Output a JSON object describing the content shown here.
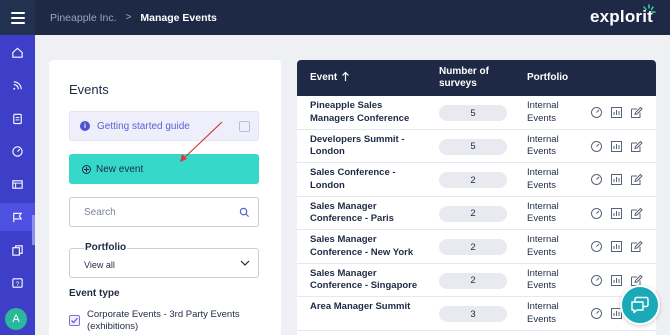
{
  "header": {
    "org": "Pineapple Inc.",
    "separator": ">",
    "page": "Manage Events",
    "logo_text": "explorit"
  },
  "nav": {
    "items": [
      "home-icon",
      "feed-icon",
      "clipboard-icon",
      "gauge-icon",
      "browser-icon",
      "flag-icon",
      "copy-icon",
      "help-icon"
    ],
    "active": "flag-icon",
    "avatar_initial": "A"
  },
  "panel": {
    "title": "Events",
    "guide_label": "Getting started guide",
    "new_event_label": "New event",
    "search_placeholder": "Search",
    "portfolio_label": "Portfolio",
    "portfolio_value": "View all",
    "event_type_title": "Event type",
    "event_type_option": "Corporate Events - 3rd Party Events (exhibitions)"
  },
  "table": {
    "columns": {
      "event": "Event",
      "number_line1": "Number of",
      "number_line2": "surveys",
      "portfolio": "Portfolio"
    },
    "rows": [
      {
        "name": "Pineapple Sales Managers Conference",
        "count": "5",
        "portfolio": "Internal Events"
      },
      {
        "name": "Developers Summit - London",
        "count": "5",
        "portfolio": "Internal Events"
      },
      {
        "name": "Sales Conference - London",
        "count": "2",
        "portfolio": "Internal Events"
      },
      {
        "name": "Sales Manager Conference - Paris",
        "count": "2",
        "portfolio": "Internal Events"
      },
      {
        "name": "Sales Manager Conference - New York",
        "count": "2",
        "portfolio": "Internal Events"
      },
      {
        "name": "Sales Manager Conference - Singapore",
        "count": "2",
        "portfolio": "Internal Events"
      },
      {
        "name": "Area Manager Summit",
        "count": "3",
        "portfolio": "Internal Events"
      }
    ],
    "row_actions": [
      "dashboard-icon",
      "report-icon",
      "edit-icon"
    ]
  },
  "colors": {
    "topbar": "#1e2a45",
    "nav": "#3d3fc9",
    "accent_teal": "#36d9c9",
    "chat": "#1aa9b6"
  }
}
